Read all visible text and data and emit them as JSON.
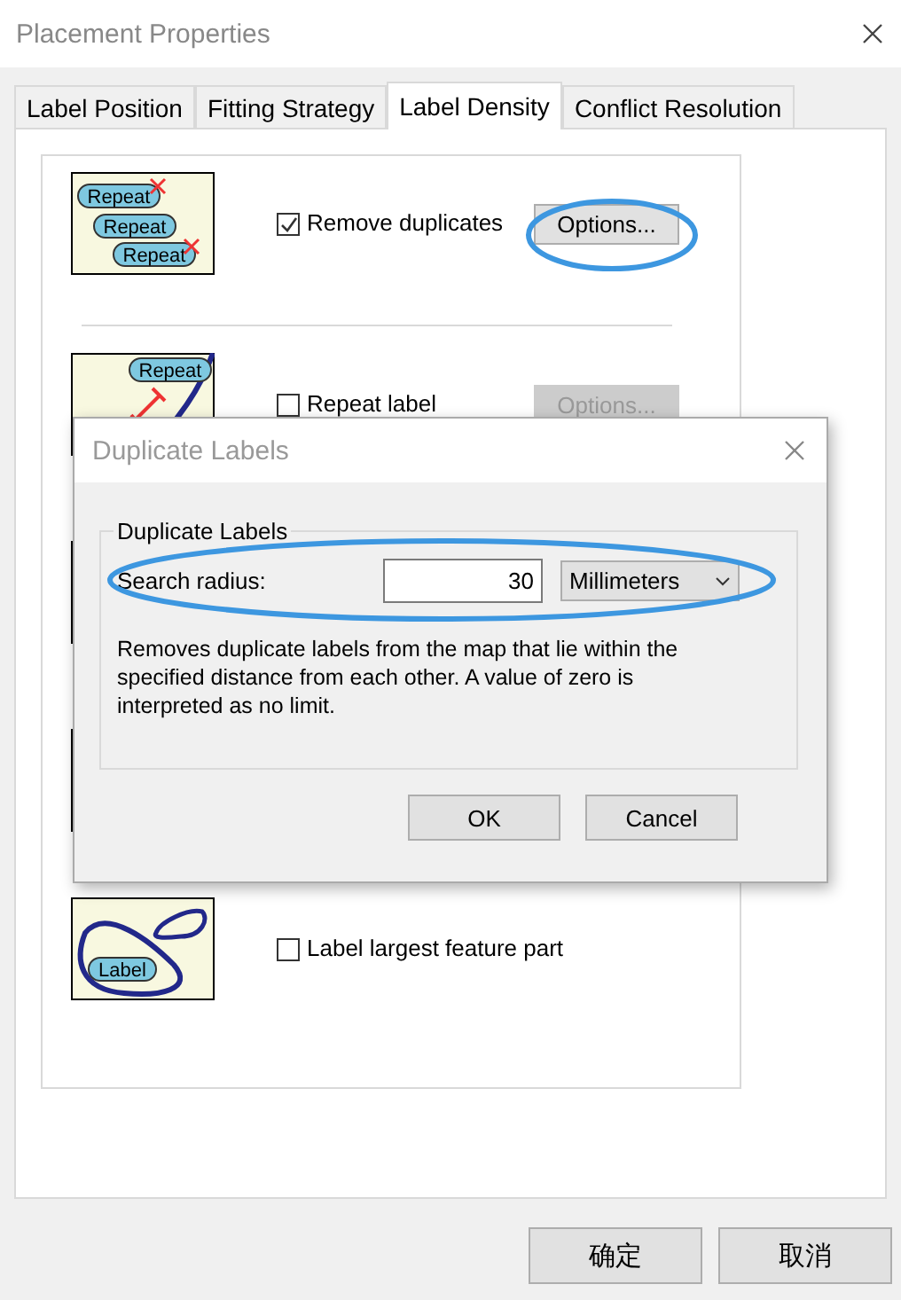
{
  "window": {
    "title": "Placement Properties"
  },
  "tabs": [
    {
      "label": "Label Position",
      "selected": false
    },
    {
      "label": "Fitting Strategy",
      "selected": false
    },
    {
      "label": "Label Density",
      "selected": true
    },
    {
      "label": "Conflict Resolution",
      "selected": false
    }
  ],
  "density_options": [
    {
      "kind": "option",
      "illustration": {
        "kind": "duplicates",
        "tags": [
          "Repeat",
          "Repeat",
          "Repeat"
        ]
      },
      "label": "Remove duplicates",
      "checked": true,
      "options_button": {
        "label": "Options...",
        "disabled": false,
        "annotated": true
      }
    },
    {
      "kind": "option",
      "illustration": {
        "kind": "repeat",
        "tags": [
          "Repeat"
        ]
      },
      "label": "Repeat label",
      "checked": false,
      "options_button": {
        "label": "Options...",
        "disabled": true
      }
    },
    {
      "kind": "hidden"
    },
    {
      "kind": "hidden"
    },
    {
      "kind": "option",
      "illustration": {
        "kind": "largest",
        "tags": [
          "Label"
        ]
      },
      "label": "Label largest feature part",
      "checked": false
    }
  ],
  "footer_buttons": [
    "确定",
    "取消"
  ],
  "dialog": {
    "title": "Duplicate Labels",
    "group_title": "Duplicate Labels",
    "search_radius": {
      "label": "Search radius:",
      "value": "30",
      "unit": "Millimeters",
      "annotated": true
    },
    "description": "Removes duplicate labels from the map that lie within the specified distance from each other. A value of zero is interpreted as no limit.",
    "buttons": [
      "OK",
      "Cancel"
    ]
  }
}
